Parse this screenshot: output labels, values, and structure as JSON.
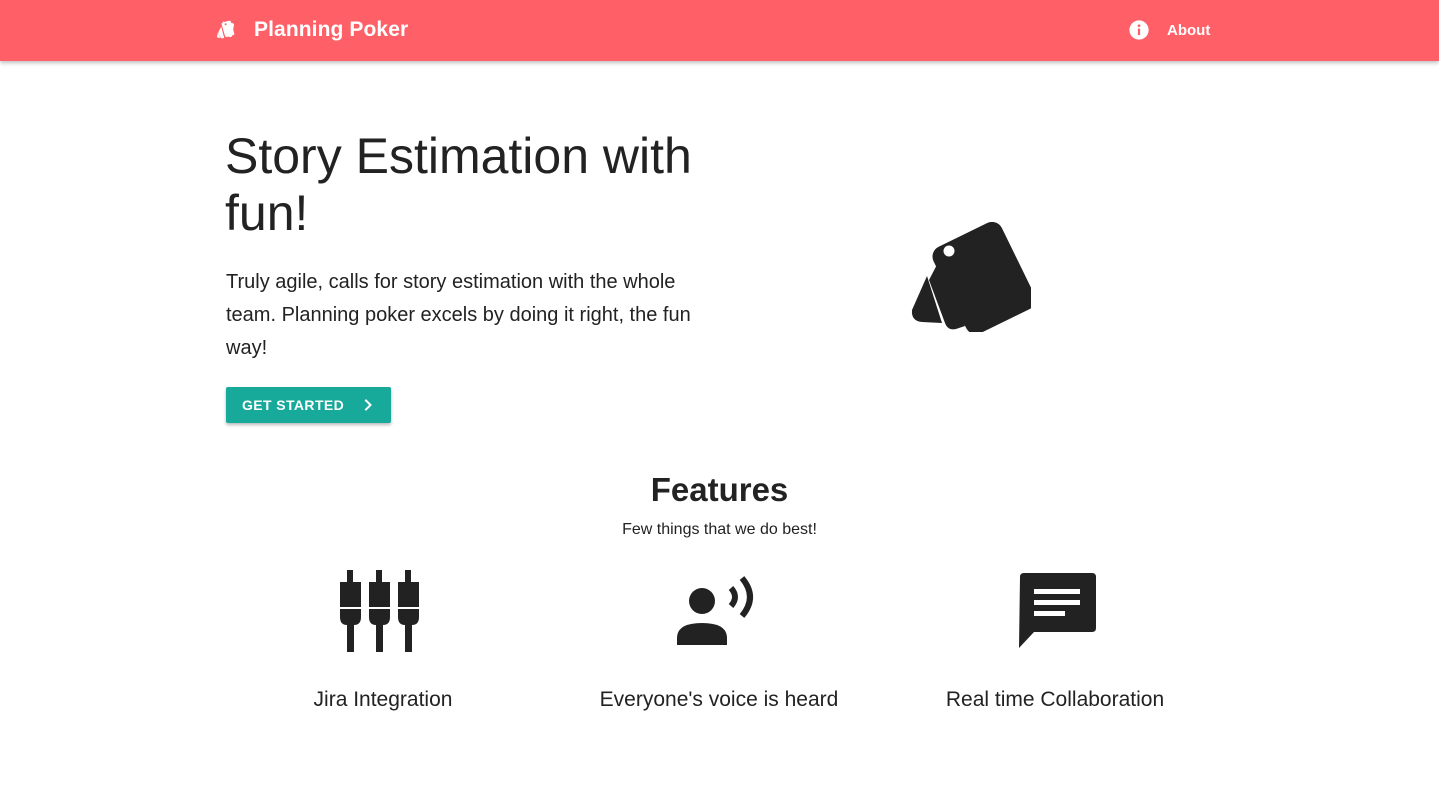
{
  "header": {
    "brand_title": "Planning Poker",
    "brand_icon": "cards-icon",
    "about_label": "About",
    "about_icon": "info-icon",
    "background_color": "#ff6068"
  },
  "hero": {
    "title": "Story Estimation with fun!",
    "description": "Truly agile, calls for story estimation with the whole team. Planning poker excels by doing it right, the fun way!",
    "cta_label": "GET STARTED",
    "cta_icon": "chevron-right-icon",
    "cta_color": "#17a99a",
    "illustration_icon": "cards-icon"
  },
  "features": {
    "title": "Features",
    "subtitle": "Few things that we do best!",
    "items": [
      {
        "label": "Jira Integration",
        "icon": "plugs-icon"
      },
      {
        "label": "Everyone's voice is heard",
        "icon": "record-voice-icon"
      },
      {
        "label": "Real time Collaboration",
        "icon": "chat-icon"
      }
    ]
  }
}
